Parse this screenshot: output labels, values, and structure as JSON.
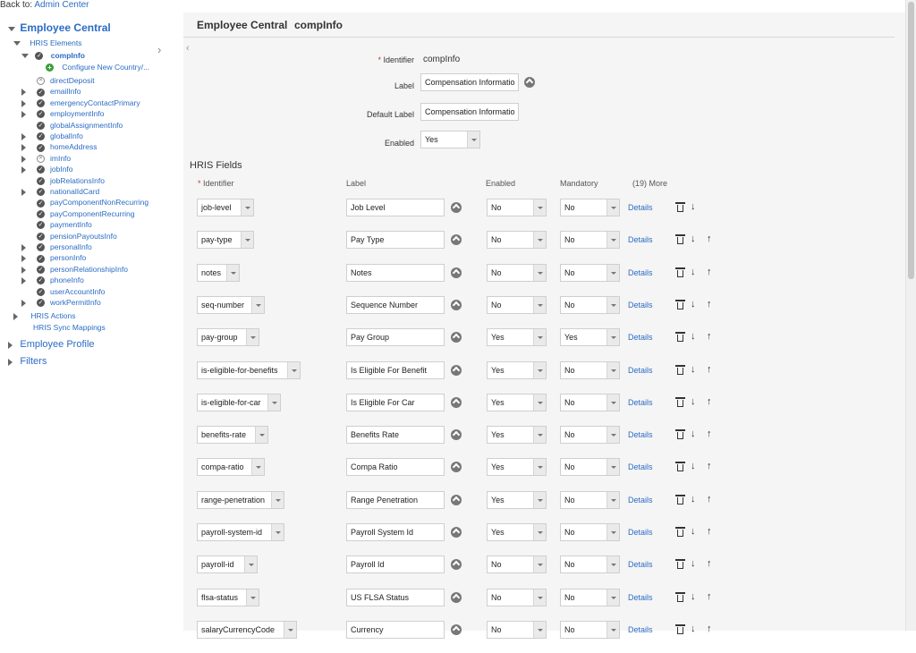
{
  "back": {
    "prefix": "Back to: ",
    "link": "Admin Center"
  },
  "tree": {
    "root": "Employee Central",
    "hris_elements": "HRIS Elements",
    "selected": "compInfo",
    "configure": "Configure New Country/...",
    "items": [
      {
        "label": "directDeposit",
        "status": "x",
        "expand": false
      },
      {
        "label": "emailInfo",
        "status": "check",
        "expand": true
      },
      {
        "label": "emergencyContactPrimary",
        "status": "check",
        "expand": true
      },
      {
        "label": "employmentInfo",
        "status": "check",
        "expand": true
      },
      {
        "label": "globalAssignmentInfo",
        "status": "check",
        "expand": false
      },
      {
        "label": "globalInfo",
        "status": "check",
        "expand": true
      },
      {
        "label": "homeAddress",
        "status": "check",
        "expand": true
      },
      {
        "label": "imInfo",
        "status": "x",
        "expand": true
      },
      {
        "label": "jobInfo",
        "status": "check",
        "expand": true
      },
      {
        "label": "jobRelationsInfo",
        "status": "check",
        "expand": false
      },
      {
        "label": "nationalIdCard",
        "status": "check",
        "expand": true
      },
      {
        "label": "payComponentNonRecurring",
        "status": "check",
        "expand": false
      },
      {
        "label": "payComponentRecurring",
        "status": "check",
        "expand": false
      },
      {
        "label": "paymentInfo",
        "status": "check",
        "expand": false
      },
      {
        "label": "pensionPayoutsInfo",
        "status": "check",
        "expand": false
      },
      {
        "label": "personalInfo",
        "status": "check",
        "expand": true
      },
      {
        "label": "personInfo",
        "status": "check",
        "expand": true
      },
      {
        "label": "personRelationshipInfo",
        "status": "check",
        "expand": true
      },
      {
        "label": "phoneInfo",
        "status": "check",
        "expand": true
      },
      {
        "label": "userAccountInfo",
        "status": "check",
        "expand": false
      },
      {
        "label": "workPermitInfo",
        "status": "check",
        "expand": true
      }
    ],
    "hris_actions": "HRIS Actions",
    "hris_sync": "HRIS Sync Mappings",
    "employee_profile": "Employee Profile",
    "filters": "Filters"
  },
  "header": {
    "title": "Employee Central",
    "subtitle": "compInfo"
  },
  "form": {
    "identifier_label": "Identifier",
    "identifier_value": "compInfo",
    "label_label": "Label",
    "label_value": "Compensation Informatio",
    "default_label_label": "Default Label",
    "default_label_value": "Compensation Informatio",
    "enabled_label": "Enabled",
    "enabled_value": "Yes"
  },
  "fields": {
    "title": "HRIS Fields",
    "columns": {
      "identifier": "Identifier",
      "label": "Label",
      "enabled": "Enabled",
      "mandatory": "Mandatory",
      "more": "(19) More"
    },
    "details_text": "Details",
    "rows": [
      {
        "id": "job-level",
        "label": "Job Level",
        "enabled": "No",
        "mandatory": "No",
        "up": false
      },
      {
        "id": "pay-type",
        "label": "Pay Type",
        "enabled": "No",
        "mandatory": "No",
        "up": true
      },
      {
        "id": "notes",
        "label": "Notes",
        "enabled": "No",
        "mandatory": "No",
        "up": true
      },
      {
        "id": "seq-number",
        "label": "Sequence Number",
        "enabled": "No",
        "mandatory": "No",
        "up": true
      },
      {
        "id": "pay-group",
        "label": "Pay Group",
        "enabled": "Yes",
        "mandatory": "Yes",
        "up": true
      },
      {
        "id": "is-eligible-for-benefits",
        "label": "Is Eligible For Benefit",
        "enabled": "Yes",
        "mandatory": "No",
        "up": true
      },
      {
        "id": "is-eligible-for-car",
        "label": "Is Eligible For Car",
        "enabled": "Yes",
        "mandatory": "No",
        "up": true
      },
      {
        "id": "benefits-rate",
        "label": "Benefits Rate",
        "enabled": "Yes",
        "mandatory": "No",
        "up": true
      },
      {
        "id": "compa-ratio",
        "label": "Compa Ratio",
        "enabled": "Yes",
        "mandatory": "No",
        "up": true
      },
      {
        "id": "range-penetration",
        "label": "Range Penetration",
        "enabled": "Yes",
        "mandatory": "No",
        "up": true
      },
      {
        "id": "payroll-system-id",
        "label": "Payroll System Id",
        "enabled": "Yes",
        "mandatory": "No",
        "up": true
      },
      {
        "id": "payroll-id",
        "label": "Payroll Id",
        "enabled": "No",
        "mandatory": "No",
        "up": true
      },
      {
        "id": "flsa-status",
        "label": "US FLSA Status",
        "enabled": "No",
        "mandatory": "No",
        "up": true
      },
      {
        "id": "salaryCurrencyCode",
        "label": "Currency",
        "enabled": "No",
        "mandatory": "No",
        "up": true
      }
    ]
  }
}
